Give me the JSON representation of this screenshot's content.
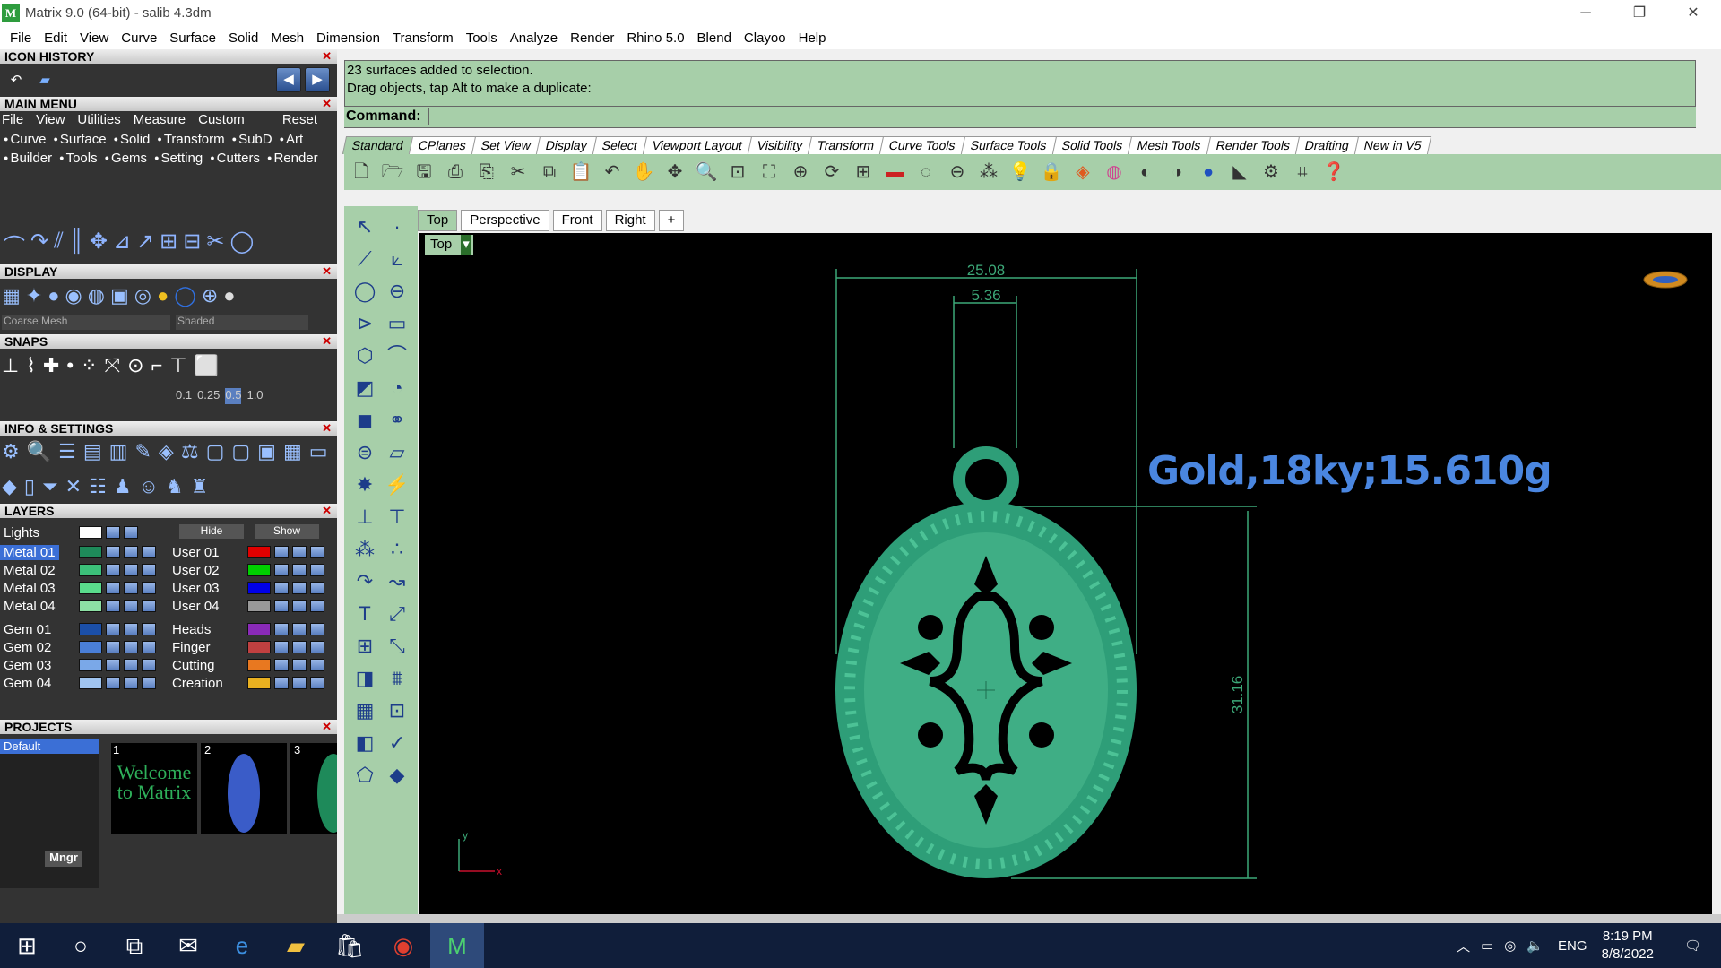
{
  "window": {
    "title": "Matrix 9.0 (64-bit) - salib 4.3dm",
    "min": "─",
    "max": "❐",
    "close": "✕"
  },
  "menu": [
    "File",
    "Edit",
    "View",
    "Curve",
    "Surface",
    "Solid",
    "Mesh",
    "Dimension",
    "Transform",
    "Tools",
    "Analyze",
    "Render",
    "Rhino 5.0",
    "Blend",
    "Clayoo",
    "Help"
  ],
  "panels": {
    "icon_history": "ICON HISTORY",
    "main_menu": "MAIN MENU",
    "main_menu_bar": [
      "File",
      "View",
      "Utilities",
      "Measure",
      "Custom",
      "Reset"
    ],
    "main_menu_row1": [
      "Curve",
      "Surface",
      "Solid",
      "Transform",
      "SubD",
      "Art"
    ],
    "main_menu_row2": [
      "Builder",
      "Tools",
      "Gems",
      "Setting",
      "Cutters",
      "Render"
    ],
    "display": "DISPLAY",
    "display_mesh": "Coarse Mesh",
    "display_shade": "Shaded",
    "snaps": "SNAPS",
    "snap_values": [
      "0.1",
      "0.25",
      "0.5",
      "1.0"
    ],
    "info": "INFO & SETTINGS",
    "layers": "LAYERS",
    "lights": "Lights",
    "hide": "Hide",
    "show": "Show",
    "layers_left": [
      "Metal 01",
      "Metal 02",
      "Metal 03",
      "Metal 04",
      "Gem 01",
      "Gem 02",
      "Gem 03",
      "Gem 04"
    ],
    "layers_right": [
      "User 01",
      "User 02",
      "User 03",
      "User 04",
      "Heads",
      "Finger",
      "Cutting",
      "Creation"
    ],
    "projects": "PROJECTS",
    "project_default": "Default",
    "project_thumbs": [
      "1",
      "2",
      "3"
    ],
    "welcome": "Welcome to Matrix",
    "mngr": "Mngr"
  },
  "colors": {
    "left": [
      "#1e8a5a",
      "#3cc07a",
      "#5adc8c",
      "#8de0a4",
      "#1b4fa8",
      "#4a7fd8",
      "#7aa8e8",
      "#a0c4f0"
    ],
    "right": [
      "#e00000",
      "#00d000",
      "#0000e8",
      "#999999",
      "#8a2ab8",
      "#c04040",
      "#e87820",
      "#e8b020"
    ]
  },
  "command": {
    "line1": "23 surfaces added to selection.",
    "line2": "Drag objects, tap Alt to make a duplicate:",
    "label": "Command:"
  },
  "tabs": [
    "Standard",
    "CPlanes",
    "Set View",
    "Display",
    "Select",
    "Viewport Layout",
    "Visibility",
    "Transform",
    "Curve Tools",
    "Surface Tools",
    "Solid Tools",
    "Mesh Tools",
    "Render Tools",
    "Drafting",
    "New in V5"
  ],
  "viewport_tabs": [
    "Top",
    "Perspective",
    "Front",
    "Right",
    "+"
  ],
  "viewport": {
    "label": "Top",
    "dim_width": "25.08",
    "dim_loop": "5.36",
    "dim_height": "31.16",
    "annotation": "Gold,18ky;15.610g",
    "axis_x": "x",
    "axis_y": "y"
  },
  "taskbar": {
    "lang": "ENG",
    "time": "8:19 PM",
    "date": "8/8/2022"
  }
}
